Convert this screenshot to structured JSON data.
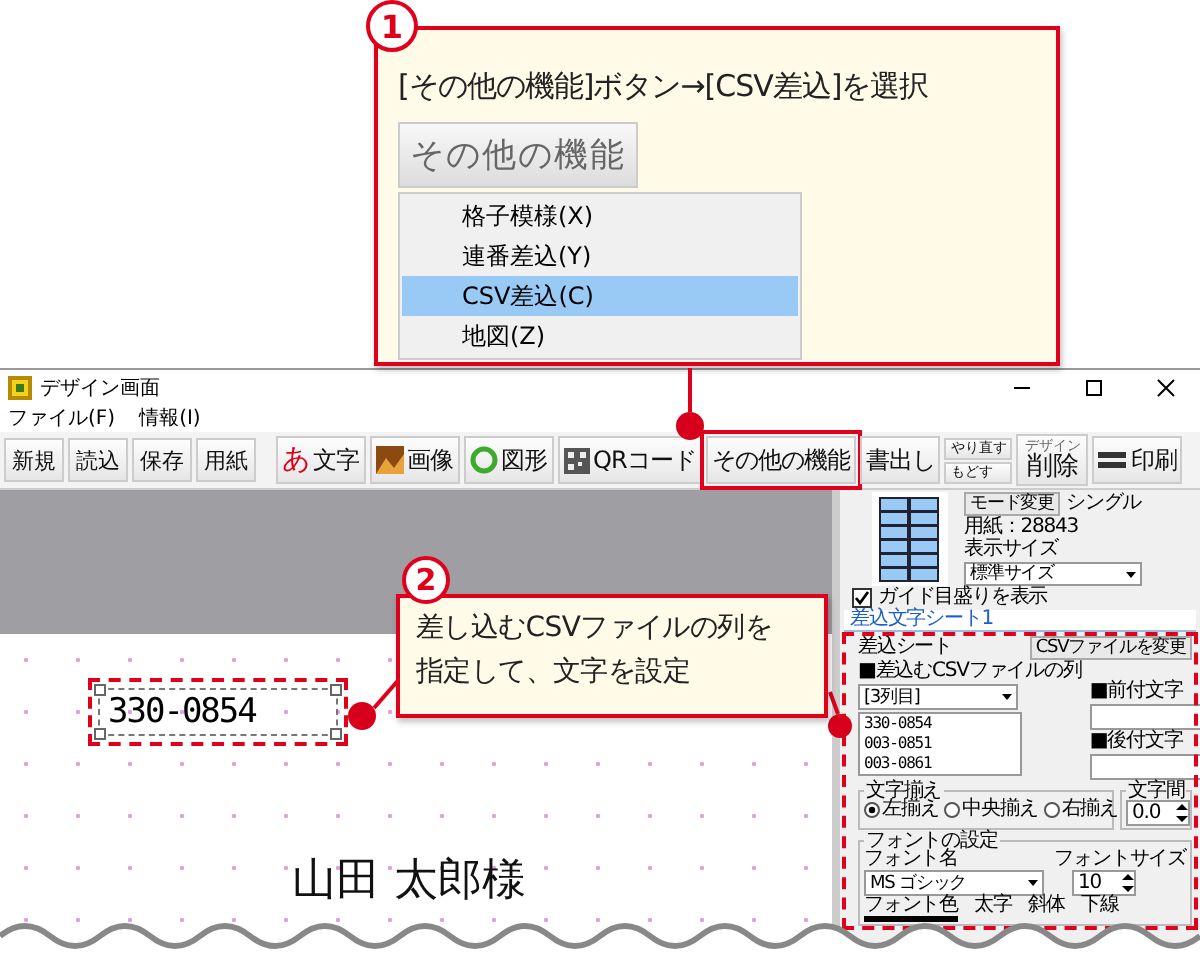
{
  "step1": {
    "number": "1",
    "instruction": "[その他の機能]ボタン→[CSV差込]を選択",
    "button": "その他の機能",
    "menu": [
      {
        "label": "格子模様(X)",
        "selected": false
      },
      {
        "label": "連番差込(Y)",
        "selected": false
      },
      {
        "label": "CSV差込(C)",
        "selected": true
      },
      {
        "label": "地図(Z)",
        "selected": false
      }
    ]
  },
  "window": {
    "title": "デザイン画面",
    "menus": [
      "ファイル(F)",
      "情報(I)"
    ],
    "toolbar": [
      {
        "kind": "plain",
        "label": "新規",
        "highlighted": false
      },
      {
        "kind": "plain",
        "label": "読込",
        "highlighted": false
      },
      {
        "kind": "plain",
        "label": "保存",
        "highlighted": false
      },
      {
        "kind": "plain",
        "label": "用紙",
        "highlighted": false
      },
      {
        "kind": "glyph",
        "glyph": "あ",
        "label": "文字",
        "highlighted": false
      },
      {
        "kind": "image",
        "label": "画像",
        "highlighted": false
      },
      {
        "kind": "shape",
        "label": "図形",
        "highlighted": false
      },
      {
        "kind": "qr",
        "label": "QRコード",
        "highlighted": false
      },
      {
        "kind": "plain",
        "label": "その他の機能",
        "highlighted": true
      },
      {
        "kind": "plain",
        "label": "書出し",
        "highlighted": false
      },
      {
        "kind": "pair",
        "top": "やり直す",
        "bottom": "もどす",
        "highlighted": false
      },
      {
        "kind": "twoline",
        "top": "デザイン",
        "bottom": "削除",
        "highlighted": false
      },
      {
        "kind": "printer",
        "label": "印刷",
        "highlighted": false
      }
    ]
  },
  "canvas": {
    "postal_code": "330-0854",
    "postal_code_highlighted": true,
    "addressee": "山田 太郎様"
  },
  "panel": {
    "mode_button": "モード変更",
    "mode": "シングル",
    "paper": "用紙：28843",
    "display_size_label": "表示サイズ",
    "display_size": "標準サイズ",
    "guide": {
      "label": "ガイド目盛りを表示",
      "checked": true
    },
    "tab": "差込文字シート1",
    "highlighted": true,
    "sheet_label": "差込シート",
    "csv_button": "CSVファイルを変更",
    "column_label": "■差込むCSVファイルの列",
    "column": "[3列目]",
    "values": [
      "330-0854",
      "003-0851",
      "003-0861"
    ],
    "prefix_label": "■前付文字",
    "suffix_label": "■後付文字",
    "align_label": "文字揃え",
    "align": [
      {
        "label": "左揃え",
        "selected": true
      },
      {
        "label": "中央揃え",
        "selected": false
      },
      {
        "label": "右揃え",
        "selected": false
      }
    ],
    "spacing_label": "文字間",
    "spacing": "0.0",
    "font_group": "フォントの設定",
    "font_name_label": "フォント名",
    "font_name": "MS ゴシック",
    "font_size_label": "フォントサイズ",
    "font_size": "10",
    "style_labels": [
      "フォント色",
      "太字",
      "斜体",
      "下線"
    ]
  },
  "step2": {
    "number": "2",
    "instruction": "差し込むCSVファイルの列を指定して、文字を設定"
  }
}
